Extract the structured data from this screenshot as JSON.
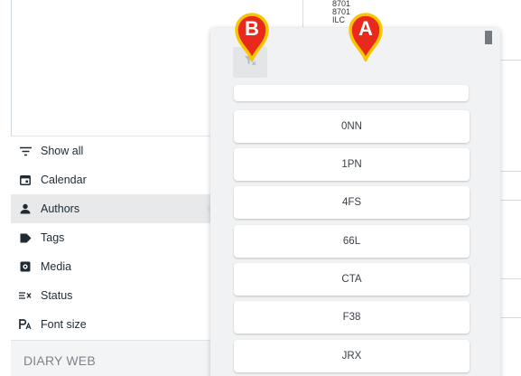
{
  "background": {
    "text_lines": [
      "8701",
      "8701",
      "ILC"
    ]
  },
  "sidebar": {
    "items": [
      {
        "label": "Show all",
        "icon": "filter-lines-icon"
      },
      {
        "label": "Calendar",
        "icon": "calendar-icon"
      },
      {
        "label": "Authors",
        "icon": "person-icon"
      },
      {
        "label": "Tags",
        "icon": "tag-icon"
      },
      {
        "label": "Media",
        "icon": "media-icon"
      },
      {
        "label": "Status",
        "icon": "status-icon"
      },
      {
        "label": "Font size",
        "icon": "font-size-icon"
      }
    ],
    "active_item": "Authors",
    "brand": "DIARY WEB"
  },
  "popup": {
    "search": {
      "value": "",
      "placeholder": ""
    },
    "filter_button_icon": "clear-filter-icon",
    "options": [
      "0NN",
      "1PN",
      "4FS",
      "66L",
      "CTA",
      "F38",
      "JRX"
    ]
  },
  "callouts": [
    {
      "letter": "A",
      "color": "#e8291c",
      "target": "author-option-list"
    },
    {
      "letter": "B",
      "color": "#e8291c",
      "target": "clear-filter-button"
    }
  ],
  "colors": {
    "marker_fill": "#e8291c",
    "marker_ring": "#f7c600",
    "active_item_bg": "#e7e9eb",
    "popup_bg": "#f1f2f3"
  }
}
